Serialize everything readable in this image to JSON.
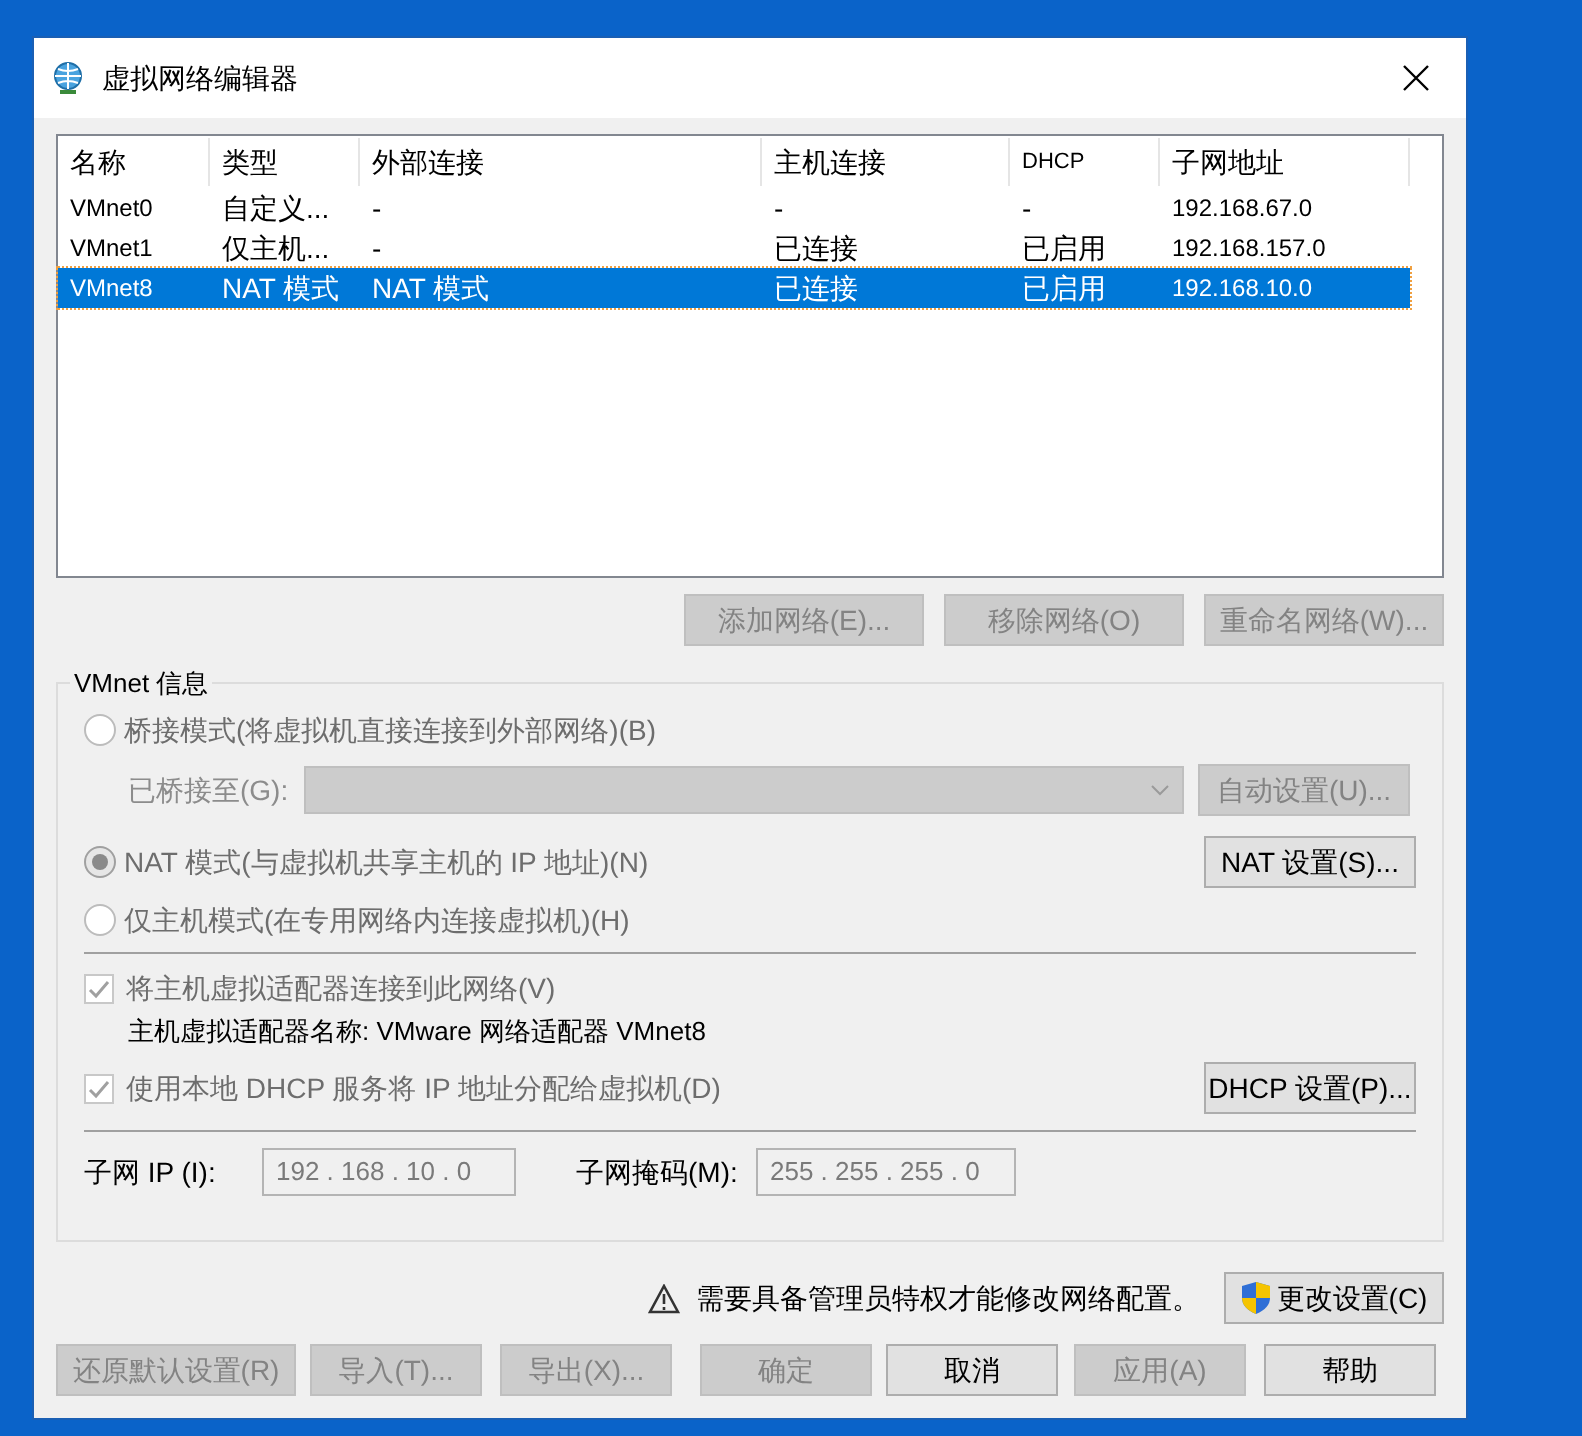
{
  "window": {
    "title": "虚拟网络编辑器"
  },
  "table": {
    "columns": [
      "名称",
      "类型",
      "外部连接",
      "主机连接",
      "DHCP",
      "子网地址"
    ],
    "rows": [
      {
        "cells": [
          "VMnet0",
          "自定义...",
          "-",
          "-",
          "-",
          "192.168.67.0"
        ],
        "selected": false
      },
      {
        "cells": [
          "VMnet1",
          "仅主机...",
          "-",
          "已连接",
          "已启用",
          "192.168.157.0"
        ],
        "selected": false
      },
      {
        "cells": [
          "VMnet8",
          "NAT 模式",
          "NAT 模式",
          "已连接",
          "已启用",
          "192.168.10.0"
        ],
        "selected": true
      }
    ]
  },
  "network_buttons": [
    {
      "label": "添加网络(E)...",
      "disabled": true
    },
    {
      "label": "移除网络(O)",
      "disabled": true
    },
    {
      "label": "重命名网络(W)...",
      "disabled": true
    }
  ],
  "info": {
    "title": "VMnet 信息",
    "modes": [
      {
        "label": "桥接模式(将虚拟机直接连接到外部网络)(B)",
        "selected": false
      },
      {
        "label": "NAT 模式(与虚拟机共享主机的 IP 地址)(N)",
        "selected": true
      },
      {
        "label": "仅主机模式(在专用网络内连接虚拟机)(H)",
        "selected": false
      }
    ],
    "bridged_label": "已桥接至(G):",
    "auto_button": {
      "label": "自动设置(U)...",
      "disabled": true
    },
    "nat_button": {
      "label": "NAT 设置(S)...",
      "disabled": false
    },
    "connect_adapter": {
      "label": "将主机虚拟适配器连接到此网络(V)",
      "checked": true
    },
    "adapter_name": "主机虚拟适配器名称: VMware 网络适配器 VMnet8",
    "use_dhcp": {
      "label": "使用本地 DHCP 服务将 IP 地址分配给虚拟机(D)",
      "checked": true
    },
    "dhcp_button": {
      "label": "DHCP 设置(P)...",
      "disabled": false
    },
    "subnet_ip_label": "子网 IP (I):",
    "subnet_ip": "192 . 168 . 10 . 0",
    "subnet_mask_label": "子网掩码(M):",
    "subnet_mask": "255 . 255 . 255 . 0"
  },
  "warning": {
    "text": "需要具备管理员特权才能修改网络配置。",
    "button": "更改设置(C)"
  },
  "footer_buttons": [
    {
      "label": "还原默认设置(R)",
      "disabled": true
    },
    {
      "label": "导入(T)...",
      "disabled": true
    },
    {
      "label": "导出(X)...",
      "disabled": true
    },
    {
      "label": "确定",
      "disabled": true
    },
    {
      "label": "取消",
      "disabled": false
    },
    {
      "label": "应用(A)",
      "disabled": true
    },
    {
      "label": "帮助",
      "disabled": false
    }
  ]
}
